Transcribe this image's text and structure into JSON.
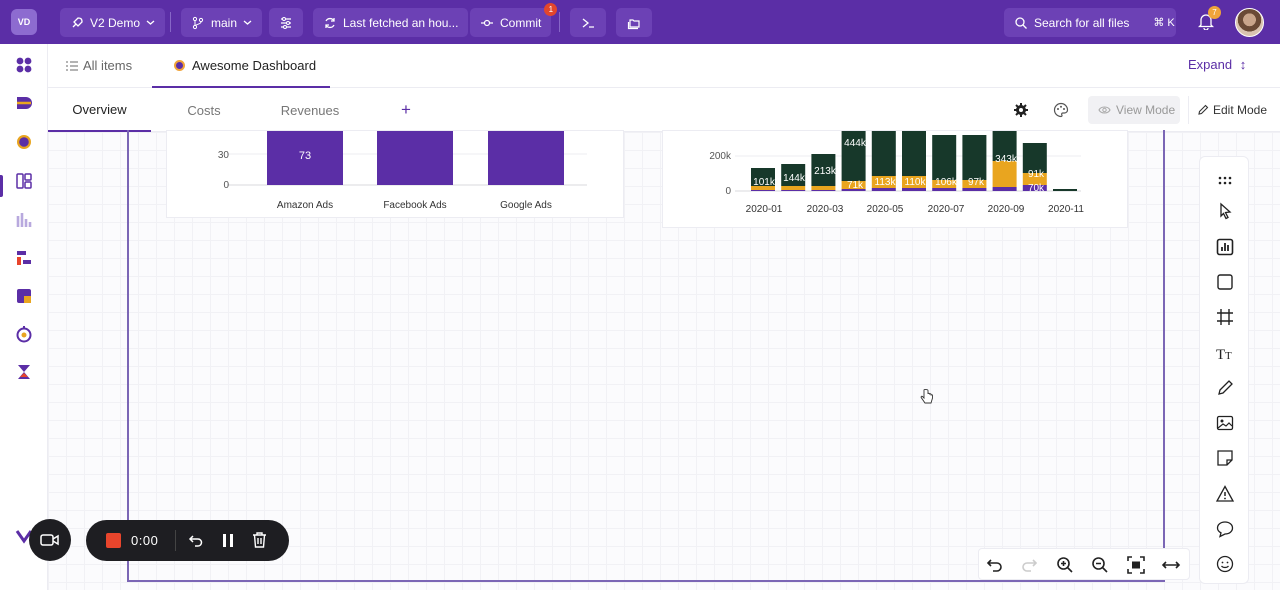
{
  "topbar": {
    "logo": "VD",
    "project": "V2 Demo",
    "branch": "main",
    "fetched": "Last fetched an hou...",
    "commit": "Commit",
    "commit_badge": "1",
    "search": "Search for all files",
    "shortcut": "⌘ K",
    "notifications": "7",
    "colors": {
      "bar": "#5b2ea6",
      "button": "#6c41b5"
    }
  },
  "header": {
    "all_items": "All items",
    "dashboard_tab": "Awesome Dashboard",
    "expand": "Expand",
    "tabs": [
      "Overview",
      "Costs",
      "Revenues"
    ],
    "add_tab": "+",
    "view_mode": "View Mode",
    "edit_mode": "Edit Mode"
  },
  "chart_data": [
    {
      "type": "bar",
      "categories": [
        "Amazon Ads",
        "Facebook Ads",
        "Google Ads"
      ],
      "values": [
        73,
        null,
        null
      ],
      "data_labels": [
        "73"
      ],
      "y_ticks": [
        "30",
        "0"
      ],
      "partial_view": true,
      "colors": {
        "bar": "#5b2ea6"
      }
    },
    {
      "type": "bar",
      "stacked": true,
      "x_tick_labels": [
        "2020-01",
        "2020-03",
        "2020-05",
        "2020-07",
        "2020-09",
        "2020-11"
      ],
      "y_ticks": [
        "200k",
        "0"
      ],
      "data_labels_dark": [
        "101k",
        "144k",
        "213k",
        "444k",
        "113k",
        "110k",
        "106k",
        "97k",
        "343k",
        "91k"
      ],
      "data_labels_yellow": [
        "71k"
      ],
      "data_labels_purple": [
        "70k"
      ],
      "partial_view": true,
      "colors": {
        "dark": "#17382a",
        "yellow": "#e9a51f",
        "purple": "#5b2ea6"
      }
    }
  ],
  "recorder": {
    "time": "0:00"
  }
}
